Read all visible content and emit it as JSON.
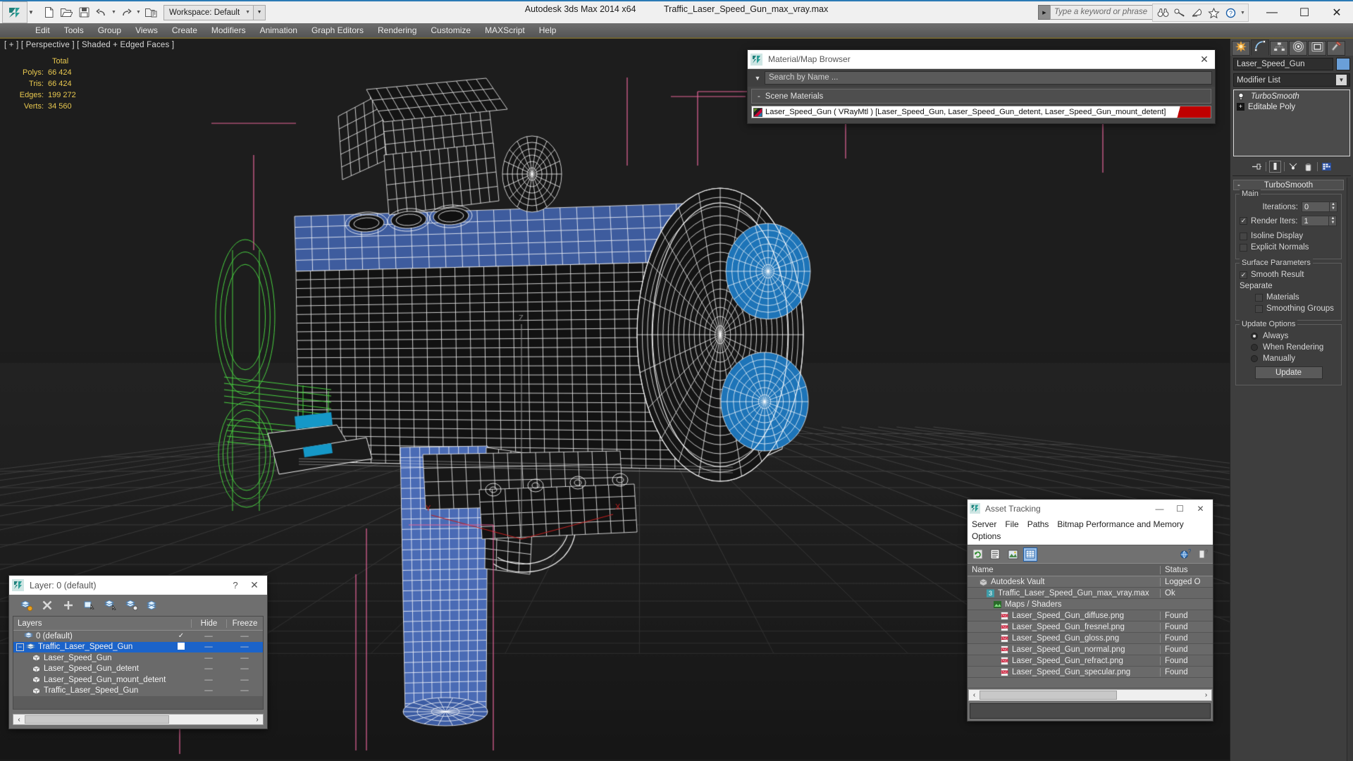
{
  "window": {
    "app_title": "Autodesk 3ds Max  2014 x64",
    "file_title": "Traffic_Laser_Speed_Gun_max_vray.max",
    "workspace_label": "Workspace: Default",
    "search_placeholder": "Type a keyword or phrase",
    "minimize": "—",
    "maximize": "☐",
    "close": "✕"
  },
  "quick_access": [
    {
      "name": "new-file-icon",
      "glyph": "new"
    },
    {
      "name": "open-file-icon",
      "glyph": "open"
    },
    {
      "name": "save-file-icon",
      "glyph": "save"
    },
    {
      "name": "undo-icon",
      "glyph": "undo"
    },
    {
      "name": "redo-icon",
      "glyph": "redo"
    },
    {
      "name": "set-project-folder-icon",
      "glyph": "project"
    }
  ],
  "help_icons": [
    {
      "name": "search-binoculars-icon"
    },
    {
      "name": "key-icon"
    },
    {
      "name": "satellite-dish-icon"
    },
    {
      "name": "favorites-star-icon"
    },
    {
      "name": "help-question-icon"
    }
  ],
  "menu": [
    "Edit",
    "Tools",
    "Group",
    "Views",
    "Create",
    "Modifiers",
    "Animation",
    "Graph Editors",
    "Rendering",
    "Customize",
    "MAXScript",
    "Help"
  ],
  "viewport": {
    "label": "[ + ] [ Perspective ] [ Shaded + Edged Faces ]",
    "stats": {
      "column_header": "Total",
      "rows": [
        {
          "label": "Polys:",
          "value": "66 424"
        },
        {
          "label": "Tris:",
          "value": "66 424"
        },
        {
          "label": "Edges:",
          "value": "199 272"
        },
        {
          "label": "Verts:",
          "value": "34 560"
        }
      ]
    },
    "axis_labels": {
      "x": "X",
      "y": "Y",
      "z": "Z"
    }
  },
  "material_browser": {
    "title": "Material/Map Browser",
    "close": "✕",
    "search_placeholder": "Search by Name ...",
    "section": {
      "minus": "-",
      "label": "Scene Materials"
    },
    "materials": [
      {
        "name": "Laser_Speed_Gun  ( VRayMtl )  [Laser_Speed_Gun, Laser_Speed_Gun_detent, Laser_Speed_Gun_mount_detent]"
      }
    ]
  },
  "asset_tracking": {
    "title": "Asset Tracking",
    "minimize": "—",
    "maximize": "☐",
    "close": "✕",
    "menu": [
      "Server",
      "File",
      "Paths",
      "Bitmap Performance and Memory",
      "Options"
    ],
    "columns": [
      "Name",
      "Status"
    ],
    "rows": [
      {
        "name": "Autodesk Vault",
        "status": "Logged O",
        "indent": 1,
        "icon": "vault-icon"
      },
      {
        "name": "Traffic_Laser_Speed_Gun_max_vray.max",
        "status": "Ok",
        "indent": 2,
        "icon": "max-file-icon"
      },
      {
        "name": "Maps / Shaders",
        "status": "",
        "indent": 3,
        "icon": "maps-icon"
      },
      {
        "name": "Laser_Speed_Gun_diffuse.png",
        "status": "Found",
        "indent": 4,
        "icon": "png-icon"
      },
      {
        "name": "Laser_Speed_Gun_fresnel.png",
        "status": "Found",
        "indent": 4,
        "icon": "png-icon"
      },
      {
        "name": "Laser_Speed_Gun_gloss.png",
        "status": "Found",
        "indent": 4,
        "icon": "png-icon"
      },
      {
        "name": "Laser_Speed_Gun_normal.png",
        "status": "Found",
        "indent": 4,
        "icon": "png-icon"
      },
      {
        "name": "Laser_Speed_Gun_refract.png",
        "status": "Found",
        "indent": 4,
        "icon": "png-icon"
      },
      {
        "name": "Laser_Speed_Gun_specular.png",
        "status": "Found",
        "indent": 4,
        "icon": "png-icon"
      }
    ],
    "scroll_left": "‹",
    "scroll_right": "›"
  },
  "layer_window": {
    "title": "Layer: 0 (default)",
    "help": "?",
    "close": "✕",
    "columns": {
      "name": "Layers",
      "hide": "Hide",
      "freeze": "Freeze"
    },
    "rows": [
      {
        "label": "0 (default)",
        "indent": 1,
        "current": "✓",
        "hide": "—",
        "freeze": "—",
        "selected": false,
        "expander": "",
        "icon": "layer-icon"
      },
      {
        "label": "Traffic_Laser_Speed_Gun",
        "indent": 0,
        "current": "box",
        "hide": "—",
        "freeze": "—",
        "selected": true,
        "expander": "−",
        "icon": "layer-icon"
      },
      {
        "label": "Laser_Speed_Gun",
        "indent": 2,
        "current": "",
        "hide": "—",
        "freeze": "—",
        "selected": false,
        "expander": "",
        "icon": "object-icon"
      },
      {
        "label": "Laser_Speed_Gun_detent",
        "indent": 2,
        "current": "",
        "hide": "—",
        "freeze": "—",
        "selected": false,
        "expander": "",
        "icon": "object-icon"
      },
      {
        "label": "Laser_Speed_Gun_mount_detent",
        "indent": 2,
        "current": "",
        "hide": "—",
        "freeze": "—",
        "selected": false,
        "expander": "",
        "icon": "object-icon"
      },
      {
        "label": "Traffic_Laser_Speed_Gun",
        "indent": 2,
        "current": "",
        "hide": "—",
        "freeze": "—",
        "selected": false,
        "expander": "",
        "icon": "object-icon"
      }
    ],
    "scroll_left": "‹",
    "scroll_right": "›"
  },
  "command_panel": {
    "tabs": [
      {
        "name": "create-tab",
        "icon": "star-burst-icon",
        "active": false
      },
      {
        "name": "modify-tab",
        "icon": "curve-icon",
        "active": true
      },
      {
        "name": "hierarchy-tab",
        "icon": "hierarchy-icon",
        "active": false
      },
      {
        "name": "motion-tab",
        "icon": "motion-wheel-icon",
        "active": false
      },
      {
        "name": "display-tab",
        "icon": "display-monitor-icon",
        "active": false
      },
      {
        "name": "utilities-tab",
        "icon": "hammer-icon",
        "active": false
      }
    ],
    "object_name": "Laser_Speed_Gun",
    "object_color": "#6a9fd8",
    "modifier_list_label": "Modifier List",
    "stack": [
      {
        "label": "TurboSmooth",
        "italic": true,
        "icon": "lightbulb-icon"
      },
      {
        "label": "Editable Poly",
        "italic": false,
        "icon": "plus-expand-icon"
      }
    ],
    "stack_tools": [
      {
        "name": "pin-stack-icon"
      },
      {
        "name": "show-end-result-icon"
      },
      {
        "name": "make-unique-icon"
      },
      {
        "name": "remove-modifier-icon"
      },
      {
        "name": "configure-modifier-sets-icon"
      }
    ],
    "rollout": {
      "minus": "-",
      "title": "TurboSmooth",
      "groups": [
        {
          "caption": "Main",
          "fields": [
            {
              "type": "spinner",
              "label": "Iterations:",
              "value": "0",
              "checkbox": null
            },
            {
              "type": "spinner",
              "label": "Render Iters:",
              "value": "1",
              "checkbox": true
            },
            {
              "type": "checkbox",
              "label": "Isoline Display",
              "checked": false
            },
            {
              "type": "checkbox",
              "label": "Explicit Normals",
              "checked": false
            }
          ]
        },
        {
          "caption": "Surface Parameters",
          "fields": [
            {
              "type": "checkbox",
              "label": "Smooth Result",
              "checked": true
            },
            {
              "type": "text",
              "label": "Separate"
            },
            {
              "type": "checkbox-indent",
              "label": "Materials",
              "checked": false
            },
            {
              "type": "checkbox-indent",
              "label": "Smoothing Groups",
              "checked": false
            }
          ]
        },
        {
          "caption": "Update Options",
          "radios": [
            {
              "label": "Always",
              "selected": true
            },
            {
              "label": "When Rendering",
              "selected": false
            },
            {
              "label": "Manually",
              "selected": false
            }
          ],
          "button": "Update"
        }
      ]
    }
  },
  "colors": {
    "accent_blue": "#2a7ab5",
    "selection_blue": "#1b63c9",
    "viewport_bg": "#1d1d1d",
    "stats_yellow": "#e8c84f",
    "wire_white": "#ffffff",
    "model_blue": "#3e5c9e",
    "lens_blue": "#1d74b8",
    "helper_green": "#49d341",
    "pink_line": "#e8659a"
  }
}
